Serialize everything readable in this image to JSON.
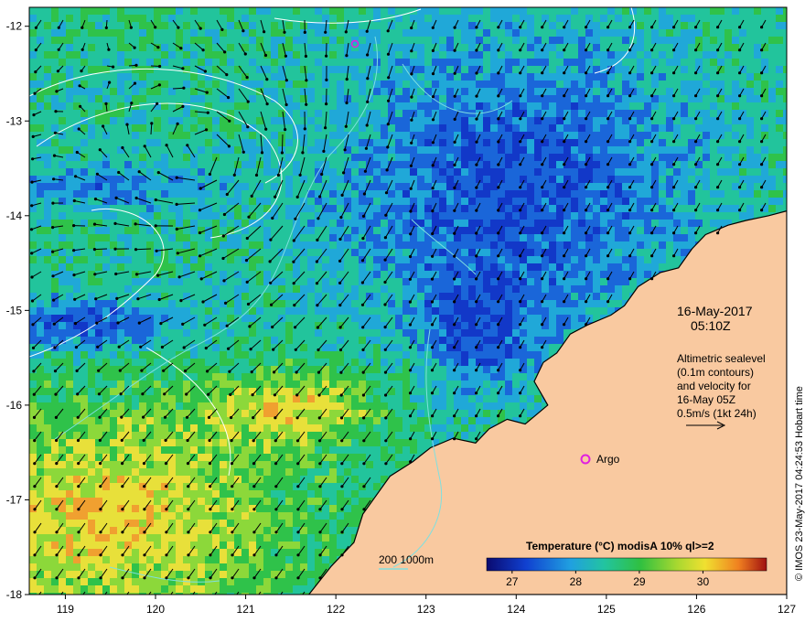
{
  "map": {
    "lon_range": [
      118.6,
      127
    ],
    "lat_range": [
      -18,
      -11.8
    ],
    "x_ticks": [
      "119",
      "120",
      "121",
      "122",
      "123",
      "124",
      "125",
      "126",
      "127"
    ],
    "y_ticks": [
      "-12",
      "-13",
      "-14",
      "-15",
      "-16",
      "-17",
      "-18"
    ],
    "colors": {
      "land": "#f9c9a0",
      "sst_cool": "#1a66d9",
      "sst_deep": "#0a2080",
      "sst_green": "#2fc24a",
      "sst_teal": "#22c49c",
      "sst_yellow": "#e8e03a",
      "sst_orange": "#f0a030",
      "contour_sealevel": "#ffffff",
      "contour_bathy": "#7fe0e0",
      "argo_marker": "#e020e0",
      "vector": "#000000"
    }
  },
  "annotations": {
    "date_line1": "16-May-2017",
    "date_line2": "05:10Z",
    "altimetry_line1": "Altimetric sealevel",
    "altimetry_line2": "(0.1m contours)",
    "altimetry_line3": "and velocity for",
    "altimetry_line4": "16-May 05Z",
    "altimetry_line5": "0.5m/s (1kt 24h)",
    "argo_label": "Argo",
    "bathymetry_label": "200  1000m"
  },
  "legend": {
    "title": "Temperature (°C) modisA 10% ql>=2",
    "ticks": [
      "27",
      "28",
      "29",
      "30"
    ],
    "tick_values": [
      27,
      28,
      29,
      30
    ],
    "range": [
      26.6,
      31.0
    ]
  },
  "credit": "© IMOS 23-May-2017 04:24:53 Hobart time",
  "icons": {
    "argo": "argo-float-circle-icon",
    "scale_arrow": "velocity-scale-arrow-icon"
  }
}
